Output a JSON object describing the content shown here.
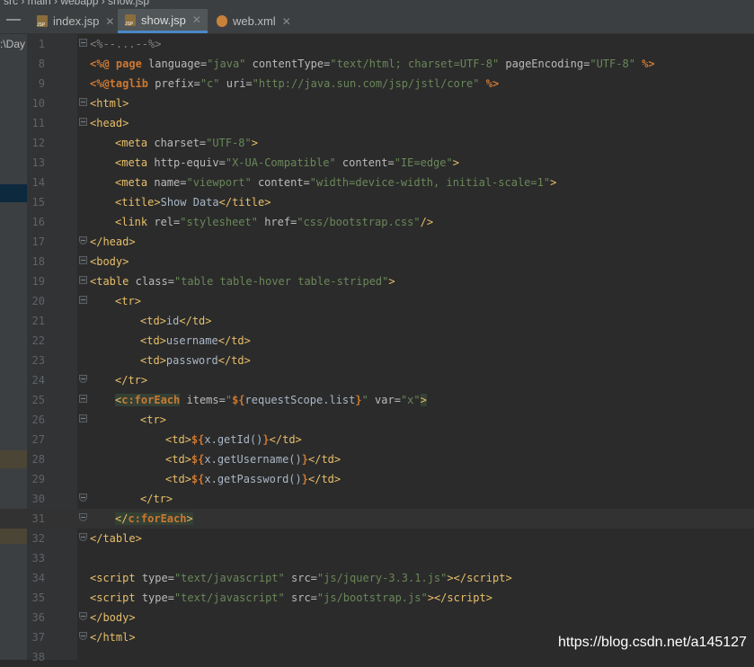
{
  "window": {
    "breadcrumb": "src › main › webapp › show.jsp",
    "side_button": "—",
    "left_panel_fragment": ":\\Day"
  },
  "tabs": [
    {
      "label": "index.jsp",
      "icon": "jsp-file-icon",
      "active": false
    },
    {
      "label": "show.jsp",
      "icon": "jsp-file-icon",
      "active": true
    },
    {
      "label": "web.xml",
      "icon": "xml-file-icon",
      "active": false
    }
  ],
  "editor": {
    "current_line": 31,
    "lines": [
      {
        "n": 1,
        "fold": "start",
        "indent": 0,
        "tokens": [
          [
            "com",
            "<%--...--%>"
          ]
        ]
      },
      {
        "n": 8,
        "indent": 0,
        "tokens": [
          [
            "dir",
            "<%@ page "
          ],
          [
            "attr",
            "language="
          ],
          [
            "str",
            "\"java\""
          ],
          [
            "attr",
            " contentType="
          ],
          [
            "str",
            "\"text/html; charset=UTF-8\""
          ],
          [
            "attr",
            " pageEncoding="
          ],
          [
            "str",
            "\"UTF-8\""
          ],
          [
            "dir",
            " %>"
          ]
        ]
      },
      {
        "n": 9,
        "indent": 0,
        "tokens": [
          [
            "dir",
            "<%@taglib "
          ],
          [
            "attr",
            "prefix="
          ],
          [
            "str",
            "\"c\""
          ],
          [
            "attr",
            " uri="
          ],
          [
            "str",
            "\"http://java.sun.com/jsp/jstl/core\""
          ],
          [
            "dir",
            " %>"
          ]
        ]
      },
      {
        "n": 10,
        "fold": "start",
        "indent": 0,
        "tokens": [
          [
            "br",
            "<"
          ],
          [
            "tag",
            "html"
          ],
          [
            "br",
            ">"
          ]
        ]
      },
      {
        "n": 11,
        "fold": "start",
        "indent": 0,
        "tokens": [
          [
            "br",
            "<"
          ],
          [
            "tag",
            "head"
          ],
          [
            "br",
            ">"
          ]
        ]
      },
      {
        "n": 12,
        "indent": 1,
        "tokens": [
          [
            "br",
            "<"
          ],
          [
            "tag",
            "meta "
          ],
          [
            "attr",
            "charset="
          ],
          [
            "str",
            "\"UTF-8\""
          ],
          [
            "br",
            ">"
          ]
        ]
      },
      {
        "n": 13,
        "indent": 1,
        "tokens": [
          [
            "br",
            "<"
          ],
          [
            "tag",
            "meta "
          ],
          [
            "attr",
            "http-equiv="
          ],
          [
            "str",
            "\"X-UA-Compatible\""
          ],
          [
            "attr",
            " content="
          ],
          [
            "str",
            "\"IE=edge\""
          ],
          [
            "br",
            ">"
          ]
        ]
      },
      {
        "n": 14,
        "indent": 1,
        "tokens": [
          [
            "br",
            "<"
          ],
          [
            "tag",
            "meta "
          ],
          [
            "attr",
            "name="
          ],
          [
            "str",
            "\"viewport\""
          ],
          [
            "attr",
            " content="
          ],
          [
            "str",
            "\"width=device-width, initial-scale=1\""
          ],
          [
            "br",
            ">"
          ]
        ]
      },
      {
        "n": 15,
        "indent": 1,
        "tokens": [
          [
            "br",
            "<"
          ],
          [
            "tag",
            "title"
          ],
          [
            "br",
            ">"
          ],
          [
            "text",
            "Show Data"
          ],
          [
            "br",
            "</"
          ],
          [
            "tag",
            "title"
          ],
          [
            "br",
            ">"
          ]
        ]
      },
      {
        "n": 16,
        "indent": 1,
        "tokens": [
          [
            "br",
            "<"
          ],
          [
            "tag",
            "link "
          ],
          [
            "attr",
            "rel="
          ],
          [
            "str",
            "\"stylesheet\""
          ],
          [
            "attr",
            " href="
          ],
          [
            "str",
            "\"css/bootstrap.css\""
          ],
          [
            "br",
            "/>"
          ]
        ]
      },
      {
        "n": 17,
        "fold": "end",
        "indent": 0,
        "tokens": [
          [
            "br",
            "</"
          ],
          [
            "tag",
            "head"
          ],
          [
            "br",
            ">"
          ]
        ]
      },
      {
        "n": 18,
        "fold": "start",
        "indent": 0,
        "tokens": [
          [
            "br",
            "<"
          ],
          [
            "tag",
            "body"
          ],
          [
            "br",
            ">"
          ]
        ]
      },
      {
        "n": 19,
        "fold": "start",
        "indent": 0,
        "tokens": [
          [
            "br",
            "<"
          ],
          [
            "tag",
            "table "
          ],
          [
            "attr",
            "class="
          ],
          [
            "str",
            "\"table table-hover table-striped\""
          ],
          [
            "br",
            ">"
          ]
        ]
      },
      {
        "n": 20,
        "fold": "start",
        "indent": 1,
        "tokens": [
          [
            "br",
            "<"
          ],
          [
            "tag",
            "tr"
          ],
          [
            "br",
            ">"
          ]
        ]
      },
      {
        "n": 21,
        "indent": 2,
        "tokens": [
          [
            "br",
            "<"
          ],
          [
            "tag",
            "td"
          ],
          [
            "br",
            ">"
          ],
          [
            "text",
            "id"
          ],
          [
            "br",
            "</"
          ],
          [
            "tag",
            "td"
          ],
          [
            "br",
            ">"
          ]
        ]
      },
      {
        "n": 22,
        "indent": 2,
        "tokens": [
          [
            "br",
            "<"
          ],
          [
            "tag",
            "td"
          ],
          [
            "br",
            ">"
          ],
          [
            "text",
            "username"
          ],
          [
            "br",
            "</"
          ],
          [
            "tag",
            "td"
          ],
          [
            "br",
            ">"
          ]
        ]
      },
      {
        "n": 23,
        "indent": 2,
        "tokens": [
          [
            "br",
            "<"
          ],
          [
            "tag",
            "td"
          ],
          [
            "br",
            ">"
          ],
          [
            "text",
            "password"
          ],
          [
            "br",
            "</"
          ],
          [
            "tag",
            "td"
          ],
          [
            "br",
            ">"
          ]
        ]
      },
      {
        "n": 24,
        "fold": "end",
        "indent": 1,
        "tokens": [
          [
            "br",
            "</"
          ],
          [
            "tag",
            "tr"
          ],
          [
            "br",
            ">"
          ]
        ]
      },
      {
        "n": 25,
        "fold": "start",
        "indent": 1,
        "tokens": [
          [
            "br",
            "<"
          ],
          [
            "el",
            "c:forEach"
          ],
          [
            "attr",
            " items="
          ],
          [
            "str",
            "\""
          ],
          [
            "el",
            "${"
          ],
          [
            "text",
            "requestScope.list"
          ],
          [
            "el",
            "}"
          ],
          [
            "str",
            "\""
          ],
          [
            "attr",
            " var="
          ],
          [
            "str",
            "\"x\""
          ],
          [
            "br",
            ">"
          ]
        ]
      },
      {
        "n": 26,
        "fold": "start",
        "indent": 2,
        "tokens": [
          [
            "br",
            "<"
          ],
          [
            "tag",
            "tr"
          ],
          [
            "br",
            ">"
          ]
        ]
      },
      {
        "n": 27,
        "indent": 3,
        "tokens": [
          [
            "br",
            "<"
          ],
          [
            "tag",
            "td"
          ],
          [
            "br",
            ">"
          ],
          [
            "el",
            "${"
          ],
          [
            "text",
            "x.getId()"
          ],
          [
            "el",
            "}"
          ],
          [
            "br",
            "</"
          ],
          [
            "tag",
            "td"
          ],
          [
            "br",
            ">"
          ]
        ]
      },
      {
        "n": 28,
        "indent": 3,
        "tokens": [
          [
            "br",
            "<"
          ],
          [
            "tag",
            "td"
          ],
          [
            "br",
            ">"
          ],
          [
            "el",
            "${"
          ],
          [
            "text",
            "x.getUsername()"
          ],
          [
            "el",
            "}"
          ],
          [
            "br",
            "</"
          ],
          [
            "tag",
            "td"
          ],
          [
            "br",
            ">"
          ]
        ]
      },
      {
        "n": 29,
        "indent": 3,
        "tokens": [
          [
            "br",
            "<"
          ],
          [
            "tag",
            "td"
          ],
          [
            "br",
            ">"
          ],
          [
            "el",
            "${"
          ],
          [
            "text",
            "x.getPassword()"
          ],
          [
            "el",
            "}"
          ],
          [
            "br",
            "</"
          ],
          [
            "tag",
            "td"
          ],
          [
            "br",
            ">"
          ]
        ]
      },
      {
        "n": 30,
        "fold": "end",
        "indent": 2,
        "tokens": [
          [
            "br",
            "</"
          ],
          [
            "tag",
            "tr"
          ],
          [
            "br",
            ">"
          ]
        ]
      },
      {
        "n": 31,
        "fold": "end",
        "indent": 1,
        "tokens": [
          [
            "br",
            "</"
          ],
          [
            "el",
            "c:forEach"
          ],
          [
            "br",
            ">"
          ]
        ]
      },
      {
        "n": 32,
        "fold": "end",
        "indent": 0,
        "tokens": [
          [
            "br",
            "</"
          ],
          [
            "tag",
            "table"
          ],
          [
            "br",
            ">"
          ]
        ]
      },
      {
        "n": 33,
        "indent": 0,
        "tokens": []
      },
      {
        "n": 34,
        "indent": 0,
        "tokens": [
          [
            "br",
            "<"
          ],
          [
            "tag",
            "script "
          ],
          [
            "attr",
            "type="
          ],
          [
            "str",
            "\"text/javascript\""
          ],
          [
            "attr",
            " src="
          ],
          [
            "str",
            "\"js/jquery-3.3.1.js\""
          ],
          [
            "br",
            "></"
          ],
          [
            "tag",
            "script"
          ],
          [
            "br",
            ">"
          ]
        ]
      },
      {
        "n": 35,
        "indent": 0,
        "tokens": [
          [
            "br",
            "<"
          ],
          [
            "tag",
            "script "
          ],
          [
            "attr",
            "type="
          ],
          [
            "str",
            "\"text/javascript\""
          ],
          [
            "attr",
            " src="
          ],
          [
            "str",
            "\"js/bootstrap.js\""
          ],
          [
            "br",
            "></"
          ],
          [
            "tag",
            "script"
          ],
          [
            "br",
            ">"
          ]
        ]
      },
      {
        "n": 36,
        "fold": "end",
        "indent": 0,
        "tokens": [
          [
            "br",
            "</"
          ],
          [
            "tag",
            "body"
          ],
          [
            "br",
            ">"
          ]
        ]
      },
      {
        "n": 37,
        "fold": "end",
        "indent": 0,
        "tokens": [
          [
            "br",
            "</"
          ],
          [
            "tag",
            "html"
          ],
          [
            "br",
            ">"
          ]
        ]
      },
      {
        "n": 38,
        "indent": 0,
        "tokens": []
      }
    ]
  },
  "watermark": "https://blog.csdn.net/a145127",
  "colors": {
    "background": "#2b2b2b",
    "gutter": "#313335",
    "tag": "#e8bf6a",
    "string": "#6a8759",
    "keyword": "#cc7832",
    "active_tab_underline": "#4a88c7"
  }
}
